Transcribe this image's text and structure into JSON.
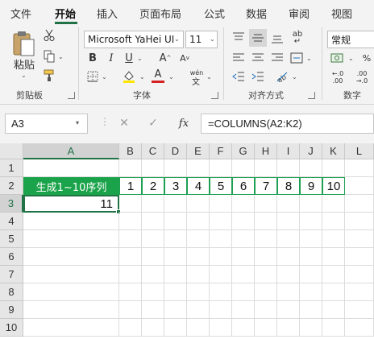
{
  "tabs": {
    "file": "文件",
    "home": "开始",
    "insert": "插入",
    "layout": "页面布局",
    "formulas": "公式",
    "data": "数据",
    "review": "审阅",
    "view": "视图"
  },
  "ribbon": {
    "paste_label": "粘贴",
    "clipboard_group": "剪贴板",
    "font_name": "Microsoft YaHei UI",
    "font_size": "11",
    "bold": "B",
    "italic": "I",
    "underline": "U",
    "grow_font": "A",
    "shrink_font": "A",
    "font_color_letter": "A",
    "phonetic": "wén",
    "font_group": "字体",
    "alignment_group": "对齐方式",
    "number_format": "常规",
    "number_group": "数字",
    "wrap_glyph": "ab",
    "decimal_up": "←.0",
    "decimal_down": ".00",
    "font_color_hex": "#d42222",
    "fill_color_hex": "#ffe600"
  },
  "formula_bar": {
    "name_box": "A3",
    "cancel": "✕",
    "enter": "✓",
    "fx": "fx",
    "formula": "=COLUMNS(A2:K2)"
  },
  "sheet": {
    "columns": [
      "A",
      "B",
      "C",
      "D",
      "E",
      "F",
      "G",
      "H",
      "I",
      "J",
      "K",
      "L"
    ],
    "rows": [
      "1",
      "2",
      "3",
      "4",
      "5",
      "6",
      "7",
      "8",
      "9",
      "10"
    ],
    "row2_title": "生成1~10序列",
    "row2_values": [
      "1",
      "2",
      "3",
      "4",
      "5",
      "6",
      "7",
      "8",
      "9",
      "10"
    ],
    "a3_value": "11",
    "active_cell": "A3",
    "accent_color": "#217346",
    "title_fill": "#1aa34a"
  }
}
